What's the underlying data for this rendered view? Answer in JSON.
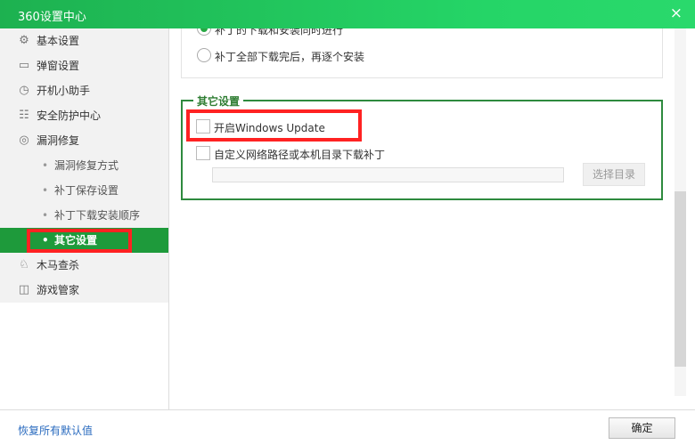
{
  "window": {
    "title": "360设置中心",
    "close_icon": "×"
  },
  "sidebar": {
    "items": [
      {
        "label": "基本设置",
        "icon": "⚙"
      },
      {
        "label": "弹窗设置",
        "icon": "▭"
      },
      {
        "label": "开机小助手",
        "icon": "◷"
      },
      {
        "label": "安全防护中心",
        "icon": "☷"
      },
      {
        "label": "漏洞修复",
        "icon": "◎"
      },
      {
        "label": "漏洞修复方式"
      },
      {
        "label": "补丁保存设置"
      },
      {
        "label": "补丁下载安装顺序"
      },
      {
        "label": "其它设置"
      },
      {
        "label": "木马查杀",
        "icon": "♘"
      },
      {
        "label": "游戏管家",
        "icon": "◫"
      }
    ]
  },
  "install_order": {
    "options": [
      "补丁的下载和安装同时进行",
      "补丁全部下载完后，再逐个安装"
    ],
    "selected": 0
  },
  "other": {
    "legend": "其它设置",
    "enable_wu": "开启Windows Update",
    "enable_wu_checked": false,
    "custom_path": "自定义网络路径或本机目录下载补丁",
    "custom_path_checked": false,
    "path_value": "",
    "choose_dir": "选择目录"
  },
  "footer": {
    "reset": "恢复所有默认值",
    "ok": "确定"
  },
  "colors": {
    "accent": "#1e9a3b",
    "highlight": "#ff2222"
  }
}
